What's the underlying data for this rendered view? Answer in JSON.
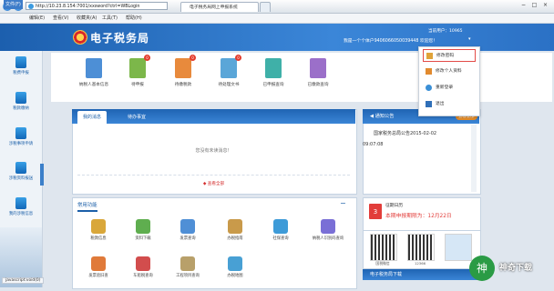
{
  "browser": {
    "url": "http://10.23.8.154:7001/xxsword?ctrl=WBLogin",
    "tab_title": "电子税务局网上申报系统",
    "menu": [
      "文件(F)",
      "编辑(E)",
      "查看(V)",
      "收藏夹(A)",
      "工具(T)",
      "帮助(H)"
    ],
    "status_url": "javascript:void(0)"
  },
  "header": {
    "title": "电子税务局",
    "account": "当前用户：10965",
    "welcome": "我是一个个体户9406066050039448 欢迎您！"
  },
  "sidebar": {
    "items": [
      {
        "label": "税费申报"
      },
      {
        "label": "税款缴纳"
      },
      {
        "label": "涉税事项申请"
      },
      {
        "label": "涉税资料报送"
      },
      {
        "label": "我的涉税信息"
      }
    ]
  },
  "quick": {
    "items": [
      {
        "label": "纳税人基本信息",
        "badge": "",
        "color": "#4d8fd6"
      },
      {
        "label": "待申报",
        "badge": "0",
        "color": "#7cb74a"
      },
      {
        "label": "待缴税款",
        "badge": "0",
        "color": "#e88a3c"
      },
      {
        "label": "待处理文书",
        "badge": "0",
        "color": "#5aa6d8"
      },
      {
        "label": "已申报查询",
        "badge": "",
        "color": "#3fb0a8"
      },
      {
        "label": "已缴款查询",
        "badge": "",
        "color": "#9b6fc9"
      }
    ]
  },
  "user_menu": {
    "items": [
      {
        "label": "修改密码"
      },
      {
        "label": "修改个人资料"
      },
      {
        "label": "重新登录"
      },
      {
        "label": "退出"
      }
    ]
  },
  "todo": {
    "tabs": [
      "我的消息",
      "待办事宜"
    ],
    "empty": "您没有未读消息！",
    "expand": "◆ 查看全部"
  },
  "notice": {
    "title": "通知公告",
    "more": "查看全部",
    "item": "国家税务总局公告2015-02-02",
    "time": "09:07:08"
  },
  "functions": {
    "title": "常用功能",
    "collapse": "−",
    "items": [
      {
        "label": "税款信息",
        "color": "#d9a73a"
      },
      {
        "label": "资料下载",
        "color": "#5fae4f"
      },
      {
        "label": "发票查询",
        "color": "#4f8fd6"
      },
      {
        "label": "办税指南",
        "color": "#c99a4a"
      },
      {
        "label": "社保查询",
        "color": "#3e9bd8"
      },
      {
        "label": "纳税人识别码查询",
        "color": "#7a6fd6"
      },
      {
        "label": "发票验旧查",
        "color": "#e07a3a"
      },
      {
        "label": "车船税查询",
        "color": "#d24d4d"
      },
      {
        "label": "工程项目查询",
        "color": "#b8a06a"
      },
      {
        "label": "办税地图",
        "color": "#48a0d4"
      }
    ]
  },
  "calendar": {
    "day": "3",
    "title": "征期日历",
    "deadline": "本期申报期限为：12月22日"
  },
  "qr": {
    "labels": [
      "国税微信",
      "12366",
      ""
    ]
  },
  "download": {
    "title": "电子税务局下载"
  },
  "watermark": {
    "logo": "神",
    "text": "神奇下载"
  }
}
